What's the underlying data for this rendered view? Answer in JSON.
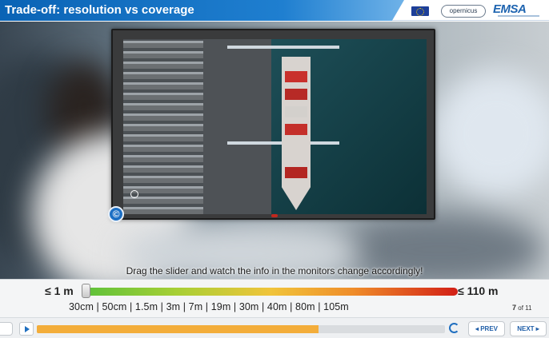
{
  "header": {
    "title": "Trade-off: resolution vs coverage",
    "logos": {
      "copernicus": "opernicus",
      "emsa": "EMSA"
    }
  },
  "colors": {
    "header_blue": "#0a63b5",
    "slider_low": "#5cc13a",
    "slider_high": "#d21f16",
    "progress_fill": "#f3ad3a",
    "button_text": "#1f5ea8"
  },
  "icons": {
    "flag": "eu-flag-icon",
    "copyright": "copyright-icon",
    "zoom": "zoom-icon",
    "play": "play-icon",
    "replay": "replay-icon"
  },
  "monitor": {
    "copyright_glyph": "©"
  },
  "instruction": "Drag the slider and watch the info in the monitors change accordingly!",
  "slider": {
    "min_label": "≤ 1 m",
    "max_label": "≤ 110 m",
    "ticks": "30cm | 50cm | 1.5m | 3m | 7m | 19m | 30m | 40m | 80m | 105m",
    "value_fraction": 0.0
  },
  "pager": {
    "current": "7",
    "of_total": "of 11"
  },
  "controls": {
    "progress_fraction": 0.69,
    "prev_label": "◂ PREV",
    "next_label": "NEXT ▸"
  }
}
